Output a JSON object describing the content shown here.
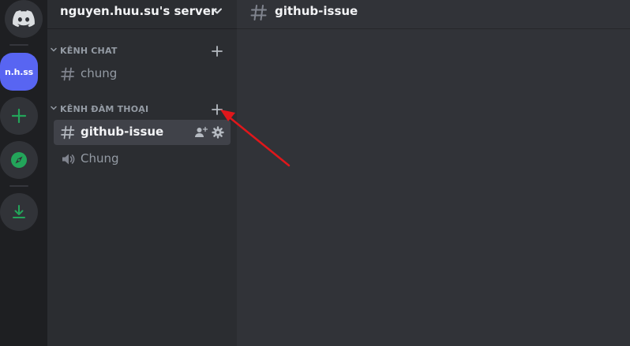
{
  "server_rail": {
    "home_icon": "discord-logo-icon",
    "servers": [
      {
        "label": "n.h.ss"
      }
    ],
    "add_server_icon": "plus-icon",
    "explore_icon": "compass-icon",
    "download_icon": "download-icon"
  },
  "channel_sidebar": {
    "server_name": "nguyen.huu.su's server",
    "categories": [
      {
        "title": "KÊNH CHAT",
        "channels": [
          {
            "name": "chung",
            "type": "text",
            "icon": "hash-icon"
          }
        ]
      },
      {
        "title": "KÊNH ĐÀM THOẠI",
        "channels": [
          {
            "name": "github-issue",
            "type": "text",
            "icon": "hash-icon",
            "selected": true,
            "actions": [
              "add-member-icon",
              "gear-icon"
            ]
          },
          {
            "name": "Chung",
            "type": "voice",
            "icon": "speaker-icon"
          }
        ]
      }
    ]
  },
  "main": {
    "channel_name": "github-issue",
    "channel_icon": "hash-icon"
  },
  "annotation": {
    "arrow_color": "#e0171b",
    "points_to": "create-channel-button-voice"
  },
  "colors": {
    "rail_bg": "#1e1f22",
    "sidebar_bg": "#2b2d31",
    "main_bg": "#313338",
    "server_accent": "#5865f2",
    "green_icon": "#23a55a",
    "selected_channel_bg": "#404249",
    "muted_text": "#949ba4",
    "bright_text": "#f2f3f5"
  }
}
